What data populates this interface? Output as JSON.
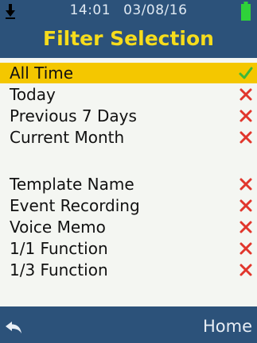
{
  "status": {
    "time": "14:01",
    "date": "03/08/16",
    "download_icon": "down-arrow-icon",
    "battery_icon": "battery-icon"
  },
  "screen": {
    "title": "Filter Selection"
  },
  "date_filters": [
    {
      "label": "All Time",
      "state": "check",
      "selected": true
    },
    {
      "label": "Today",
      "state": "cross",
      "selected": false
    },
    {
      "label": "Previous 7 Days",
      "state": "cross",
      "selected": false
    },
    {
      "label": "Current Month",
      "state": "cross",
      "selected": false
    }
  ],
  "type_filters": [
    {
      "label": "Template Name",
      "state": "cross"
    },
    {
      "label": "Event Recording",
      "state": "cross"
    },
    {
      "label": "Voice Memo",
      "state": "cross"
    },
    {
      "label": "1/1 Function",
      "state": "cross"
    },
    {
      "label": "1/3 Function",
      "state": "cross"
    }
  ],
  "footer": {
    "back_icon": "back-arrow-icon",
    "home_label": "Home"
  },
  "colors": {
    "header_bg": "#2c527a",
    "title": "#f6dc1c",
    "selected_bg": "#f4c700",
    "check": "#3db83a",
    "cross": "#e1362c",
    "battery": "#2fd23a"
  }
}
